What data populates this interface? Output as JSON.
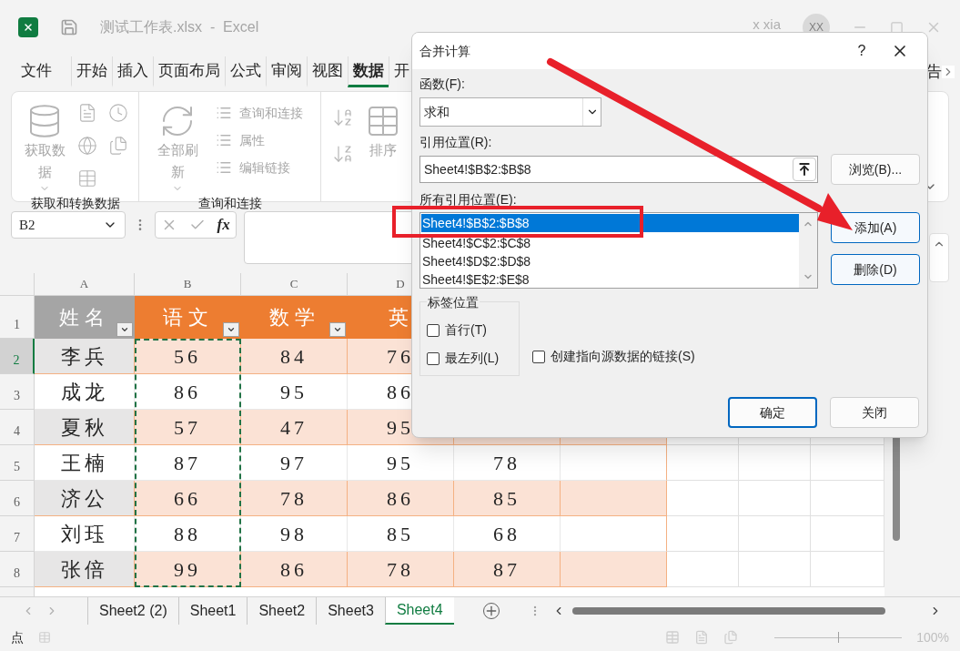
{
  "window": {
    "title": "测试工作表.xlsx  -  Excel",
    "user": "x xia",
    "avatar": "XX"
  },
  "ribbon_tabs": [
    {
      "label": "文件",
      "selected": false
    },
    {
      "label": "开始",
      "selected": false
    },
    {
      "label": "插入",
      "selected": false
    },
    {
      "label": "页面布局",
      "selected": false
    },
    {
      "label": "公式",
      "selected": false
    },
    {
      "label": "审阅",
      "selected": false
    },
    {
      "label": "视图",
      "selected": false
    },
    {
      "label": "数据",
      "selected": true
    },
    {
      "label": "开",
      "selected": false
    }
  ],
  "tell_me": "告",
  "ribbon_groups": [
    {
      "label": "获取和转换数据",
      "commands": [
        {
          "kind": "big",
          "label": "获取数据",
          "disabled": true,
          "menu": true
        }
      ]
    },
    {
      "label": "查询和连接",
      "commands": [
        {
          "kind": "big",
          "label": "全部刷新",
          "disabled": true,
          "menu": true
        },
        {
          "kind": "small",
          "label": "查询和连接",
          "disabled": true
        },
        {
          "kind": "small",
          "label": "属性",
          "disabled": true
        },
        {
          "kind": "small",
          "label": "编辑链接",
          "disabled": true
        }
      ]
    },
    {
      "commands": [
        {
          "kind": "big",
          "label": "排序",
          "disabled": true,
          "menu": false
        }
      ]
    }
  ],
  "formula_bar": {
    "name_box": "B2",
    "function_symbol": "fx"
  },
  "sheet": {
    "columns": [
      "A",
      "B",
      "C",
      "D"
    ],
    "header_row": {
      "number": "1",
      "cells": [
        {
          "text": "姓名",
          "filter": true
        },
        {
          "text": "语文",
          "filter": true
        },
        {
          "text": "数学",
          "filter": true
        },
        {
          "text": "英",
          "filter": false
        }
      ]
    },
    "rows": [
      {
        "number": "2",
        "selected": true,
        "cells": [
          "李兵",
          "56",
          "84",
          "76"
        ]
      },
      {
        "number": "3",
        "selected": false,
        "cells": [
          "成龙",
          "86",
          "95",
          "86"
        ]
      },
      {
        "number": "4",
        "selected": false,
        "cells": [
          "夏秋",
          "57",
          "47",
          "95"
        ]
      },
      {
        "number": "5",
        "selected": false,
        "cells": [
          "王楠",
          "87",
          "97",
          "95",
          "78"
        ]
      },
      {
        "number": "6",
        "selected": false,
        "cells": [
          "济公",
          "66",
          "78",
          "86",
          "85"
        ]
      },
      {
        "number": "7",
        "selected": false,
        "cells": [
          "刘珏",
          "88",
          "98",
          "85",
          "68"
        ]
      },
      {
        "number": "8",
        "selected": false,
        "cells": [
          "张倍",
          "99",
          "86",
          "78",
          "87"
        ]
      }
    ]
  },
  "sheet_tabs": [
    {
      "label": "Sheet2 (2)",
      "selected": false
    },
    {
      "label": "Sheet1",
      "selected": false
    },
    {
      "label": "Sheet2",
      "selected": false
    },
    {
      "label": "Sheet3",
      "selected": false
    },
    {
      "label": "Sheet4",
      "selected": true
    }
  ],
  "status_bar": {
    "mode": "点",
    "zoom": "100%",
    "zoom_slider": {
      "level": 0.5
    }
  },
  "dialog": {
    "title": "合并计算",
    "help": "?",
    "function_label": "函数(F):",
    "function_value": "求和",
    "reference_label": "引用位置(R):",
    "reference_value": "Sheet4!$B$2:$B$8",
    "browse_button": "浏览(B)...",
    "all_references_label": "所有引用位置(E):",
    "references": [
      {
        "text": "Sheet4!$B$2:$B$8",
        "selected": true
      },
      {
        "text": "Sheet4!$C$2:$C$8",
        "selected": false
      },
      {
        "text": "Sheet4!$D$2:$D$8",
        "selected": false
      },
      {
        "text": "Sheet4!$E$2:$E$8",
        "selected": false
      }
    ],
    "add_button": "添加(A)",
    "delete_button": "删除(D)",
    "label_position": {
      "title": "标签位置",
      "options": [
        {
          "label": "首行(T)",
          "checked": false
        },
        {
          "label": "最左列(L)",
          "checked": false
        }
      ]
    },
    "link_option": {
      "label": "创建指向源数据的链接(S)",
      "checked": false
    },
    "ok_button": "确定",
    "close_button": "关闭"
  }
}
